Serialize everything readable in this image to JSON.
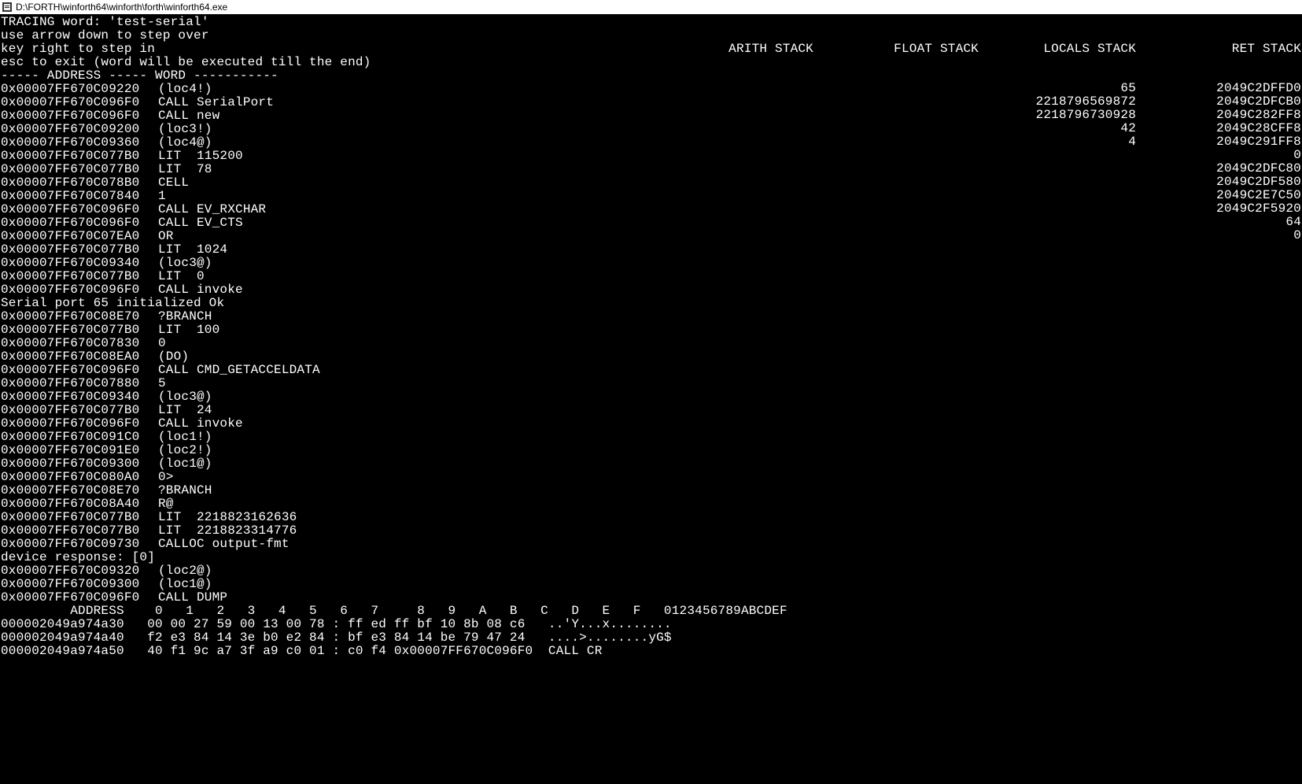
{
  "window": {
    "title": "D:\\FORTH\\winforth64\\winforth\\forth\\winforth64.exe"
  },
  "header_lines": [
    "TRACING word: 'test-serial'",
    "use arrow down to step over",
    "key right to step in",
    "esc to exit (word will be executed till the end)",
    "----- ADDRESS ----- WORD -----------"
  ],
  "stack_headers": {
    "arith": "ARITH STACK",
    "float": "FLOAT STACK",
    "locals": "LOCALS STACK",
    "ret": "RET STACK"
  },
  "locals_stack": [
    "65",
    "2218796569872",
    "2218796730928",
    "42",
    "4"
  ],
  "ret_stack": [
    "2049C2DFFD0",
    "2049C2DFCB0",
    "2049C282FF8",
    "2049C28CFF8",
    "2049C291FF8",
    "0",
    "2049C2DFC80",
    "2049C2DF580",
    "2049C2E7C50",
    "2049C2F5920",
    "64",
    "0"
  ],
  "trace_rows": [
    {
      "addr": "0x00007FF670C09220",
      "word": "(loc4!)"
    },
    {
      "addr": "0x00007FF670C096F0",
      "word": "CALL SerialPort"
    },
    {
      "addr": "0x00007FF670C096F0",
      "word": "CALL new"
    },
    {
      "addr": "0x00007FF670C09200",
      "word": "(loc3!)"
    },
    {
      "addr": "0x00007FF670C09360",
      "word": "(loc4@)"
    },
    {
      "addr": "0x00007FF670C077B0",
      "word": "LIT  115200"
    },
    {
      "addr": "0x00007FF670C077B0",
      "word": "LIT  78"
    },
    {
      "addr": "0x00007FF670C078B0",
      "word": "CELL"
    },
    {
      "addr": "0x00007FF670C07840",
      "word": "1"
    },
    {
      "addr": "0x00007FF670C096F0",
      "word": "CALL EV_RXCHAR"
    },
    {
      "addr": "0x00007FF670C096F0",
      "word": "CALL EV_CTS"
    },
    {
      "addr": "0x00007FF670C07EA0",
      "word": "OR"
    },
    {
      "addr": "0x00007FF670C077B0",
      "word": "LIT  1024"
    },
    {
      "addr": "0x00007FF670C09340",
      "word": "(loc3@)"
    },
    {
      "addr": "0x00007FF670C077B0",
      "word": "LIT  0"
    },
    {
      "addr": "0x00007FF670C096F0",
      "word": "CALL invoke"
    },
    {
      "addr": "",
      "word": "Serial port 65 initialized Ok"
    },
    {
      "addr": "0x00007FF670C08E70",
      "word": "?BRANCH"
    },
    {
      "addr": "0x00007FF670C077B0",
      "word": "LIT  100"
    },
    {
      "addr": "0x00007FF670C07830",
      "word": "0"
    },
    {
      "addr": "0x00007FF670C08EA0",
      "word": "(DO)"
    },
    {
      "addr": "0x00007FF670C096F0",
      "word": "CALL CMD_GETACCELDATA"
    },
    {
      "addr": "0x00007FF670C07880",
      "word": "5"
    },
    {
      "addr": "0x00007FF670C09340",
      "word": "(loc3@)"
    },
    {
      "addr": "0x00007FF670C077B0",
      "word": "LIT  24"
    },
    {
      "addr": "0x00007FF670C096F0",
      "word": "CALL invoke"
    },
    {
      "addr": "0x00007FF670C091C0",
      "word": "(loc1!)"
    },
    {
      "addr": "0x00007FF670C091E0",
      "word": "(loc2!)"
    },
    {
      "addr": "0x00007FF670C09300",
      "word": "(loc1@)"
    },
    {
      "addr": "0x00007FF670C080A0",
      "word": "0>"
    },
    {
      "addr": "0x00007FF670C08E70",
      "word": "?BRANCH"
    },
    {
      "addr": "0x00007FF670C08A40",
      "word": "R@"
    },
    {
      "addr": "0x00007FF670C077B0",
      "word": "LIT  2218823162636"
    },
    {
      "addr": "0x00007FF670C077B0",
      "word": "LIT  2218823314776"
    },
    {
      "addr": "0x00007FF670C09730",
      "word": "CALLOC output-fmt"
    },
    {
      "addr": "",
      "word": "device response: [0]"
    },
    {
      "addr": "0x00007FF670C09320",
      "word": "(loc2@)"
    },
    {
      "addr": "0x00007FF670C09300",
      "word": "(loc1@)"
    },
    {
      "addr": "0x00007FF670C096F0",
      "word": "CALL DUMP"
    }
  ],
  "dump_header": "         ADDRESS    0   1   2   3   4   5   6   7     8   9   A   B   C   D   E   F   0123456789ABCDEF",
  "dump_rows": [
    "000002049a974a30   00 00 27 59 00 13 00 78 : ff ed ff bf 10 8b 08 c6   ..'Y...x........",
    "000002049a974a40   f2 e3 84 14 3e b0 e2 84 : bf e3 84 14 be 79 47 24   ....>........yG$",
    "000002049a974a50   40 f1 9c a7 3f a9 c0 01 : c0 f4 0x00007FF670C096F0  CALL CR"
  ]
}
